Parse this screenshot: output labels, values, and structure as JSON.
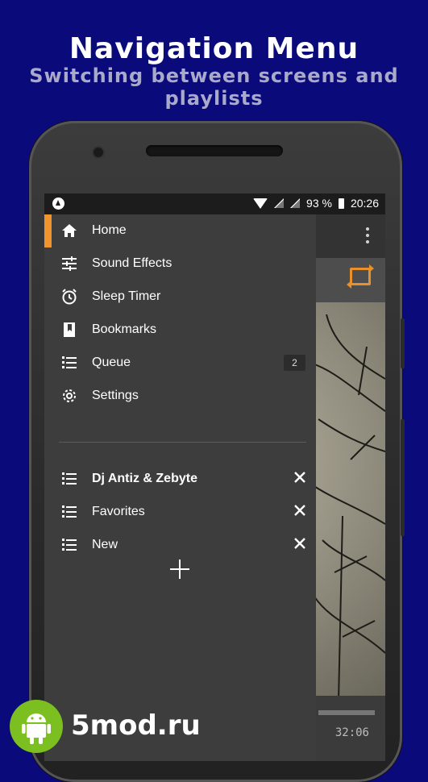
{
  "promo": {
    "title": "Navigation Menu",
    "subtitle": "Switching between screens and playlists"
  },
  "status_bar": {
    "battery": "93 %",
    "time": "20:26"
  },
  "drawer": {
    "screens": [
      {
        "label": "Home",
        "icon": "home-icon",
        "active": true
      },
      {
        "label": "Sound Effects",
        "icon": "equalizer-icon"
      },
      {
        "label": "Sleep Timer",
        "icon": "alarm-clock-icon"
      },
      {
        "label": "Bookmarks",
        "icon": "bookmark-icon"
      },
      {
        "label": "Queue",
        "icon": "queue-list-icon",
        "badge": "2"
      },
      {
        "label": "Settings",
        "icon": "gear-icon"
      }
    ],
    "playlists": [
      {
        "label": "Dj Antiz & Zebyte",
        "icon": "playlist-icon",
        "current": true
      },
      {
        "label": "Favorites",
        "icon": "playlist-icon"
      },
      {
        "label": "New",
        "icon": "playlist-icon"
      }
    ],
    "add_icon": "plus-icon"
  },
  "player": {
    "time": "32:06"
  },
  "watermark": {
    "text": "5mod.ru",
    "icon": "android-robot-icon"
  },
  "colors": {
    "background": "#0a0a7a",
    "accent": "#f0952b",
    "drawer": "#3d3d3d"
  }
}
